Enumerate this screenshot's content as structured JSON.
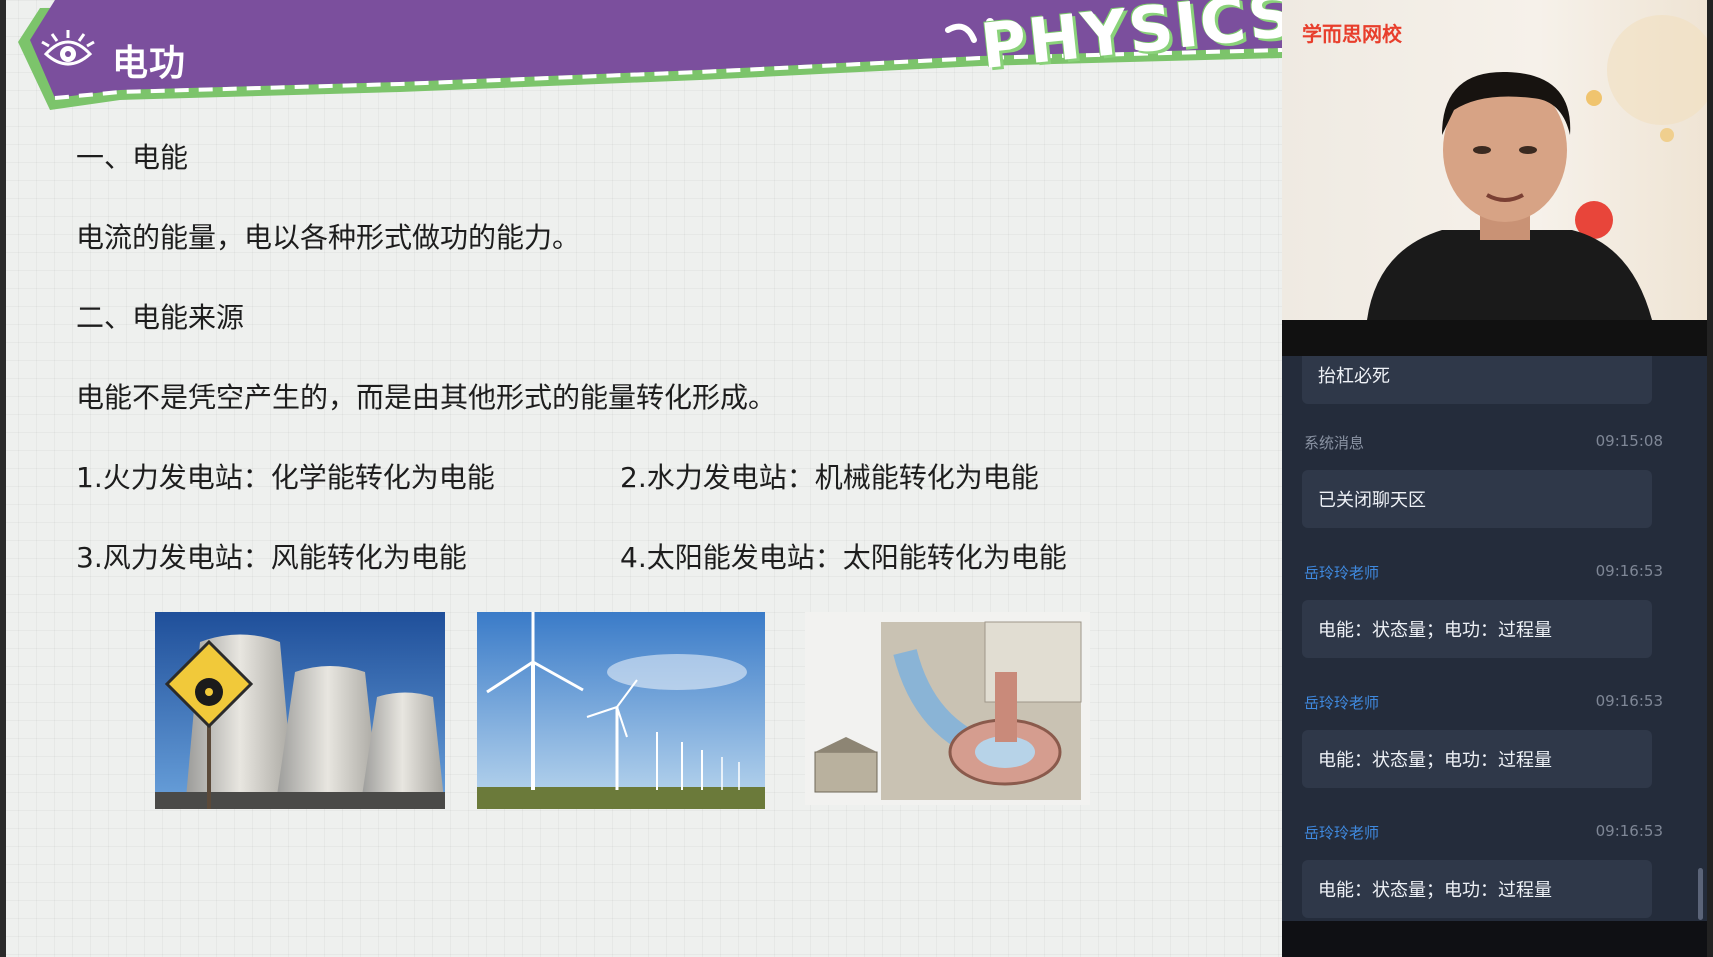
{
  "slide": {
    "title": "电功",
    "decor_word": "PHYSICS",
    "heading1": "一、电能",
    "para1": "电流的能量，电以各种形式做功的能力。",
    "heading2": "二、电能来源",
    "para2": "电能不是凭空产生的，而是由其他形式的能量转化形成。",
    "items": [
      "1.火力发电站：化学能转化为电能",
      "2.水力发电站：机械能转化为电能",
      "3.风力发电站：风能转化为电能",
      "4.太阳能发电站：太阳能转化为电能"
    ]
  },
  "video": {
    "brand": "学而思网校"
  },
  "chat": {
    "messages": [
      {
        "sender": "",
        "time": "",
        "text": "抬杠必死"
      },
      {
        "sender": "系统消息",
        "time": "09:15:08",
        "text": "已关闭聊天区"
      },
      {
        "sender": "岳玲玲老师",
        "time": "09:16:53",
        "text": "电能：状态量；电功：过程量"
      },
      {
        "sender": "岳玲玲老师",
        "time": "09:16:53",
        "text": "电能：状态量；电功：过程量"
      },
      {
        "sender": "岳玲玲老师",
        "time": "09:16:53",
        "text": "电能：状态量；电功：过程量"
      }
    ]
  },
  "colors": {
    "banner_purple": "#7b4f9d",
    "banner_green": "#7cc46b",
    "teacher_name": "#3f8ae0",
    "system_name": "#8a93a3",
    "brand_red": "#e83e2c"
  }
}
